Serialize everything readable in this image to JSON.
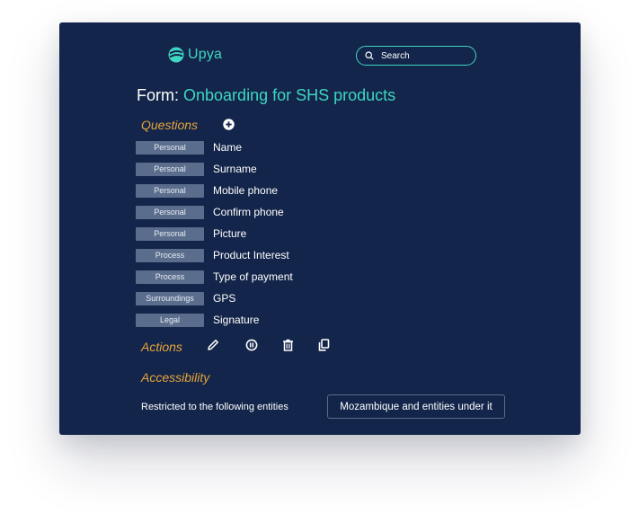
{
  "app": {
    "name": "Upya"
  },
  "search": {
    "label": "Search"
  },
  "form": {
    "prefix": "Form:",
    "name": "Onboarding for SHS products"
  },
  "sections": {
    "questions": "Questions",
    "actions": "Actions",
    "accessibility": "Accessibility"
  },
  "questions": [
    {
      "category": "Personal",
      "name": "Name"
    },
    {
      "category": "Personal",
      "name": "Surname"
    },
    {
      "category": "Personal",
      "name": "Mobile phone"
    },
    {
      "category": "Personal",
      "name": "Confirm phone"
    },
    {
      "category": "Personal",
      "name": "Picture"
    },
    {
      "category": "Process",
      "name": "Product Interest"
    },
    {
      "category": "Process",
      "name": "Type of payment"
    },
    {
      "category": "Surroundings",
      "name": "GPS"
    },
    {
      "category": "Legal",
      "name": "Signature"
    }
  ],
  "action_icons": [
    "pencil-icon",
    "pause-icon",
    "trash-icon",
    "copy-icon"
  ],
  "accessibility": {
    "label": "Restricted to the following entities",
    "value": "Mozambique and entities under it"
  },
  "colors": {
    "background": "#13254a",
    "accent": "#3fd6c2",
    "section_heading": "#e8a53a",
    "tag": "#5b6d8d"
  }
}
